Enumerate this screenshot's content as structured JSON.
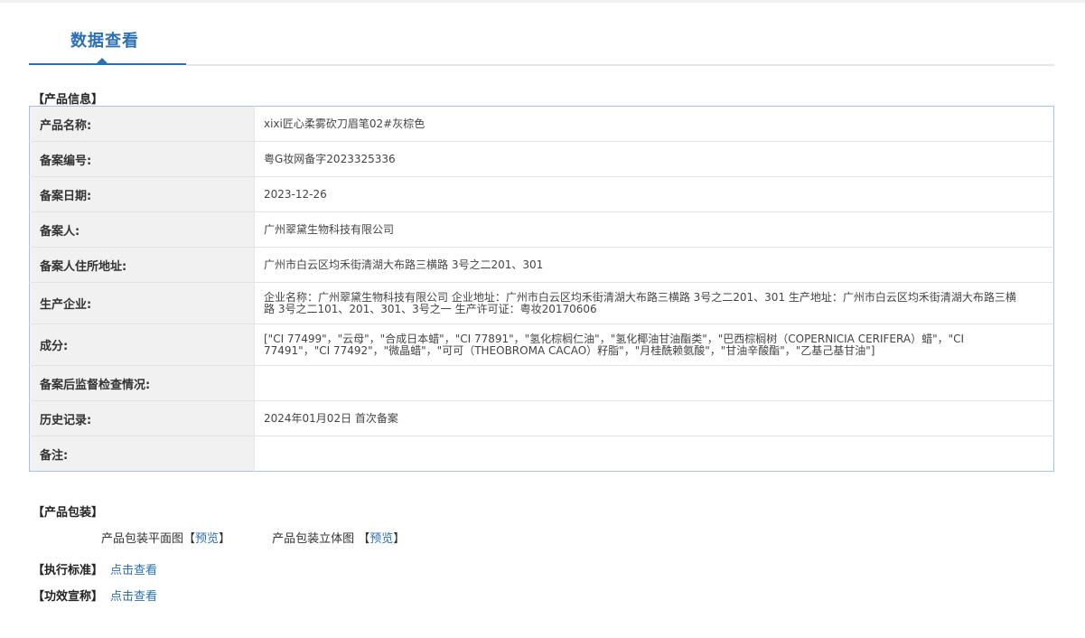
{
  "tab": {
    "title": "数据查看"
  },
  "sections": {
    "product_info": "【产品信息】",
    "packaging": "【产品包装】",
    "standard": "【执行标准】",
    "efficacy": "【功效宣称】"
  },
  "info_rows": [
    {
      "label": "产品名称:",
      "value": "xixi匠心柔雾砍刀眉笔02#灰棕色"
    },
    {
      "label": "备案编号:",
      "value": "粤G妆网备字2023325336"
    },
    {
      "label": "备案日期:",
      "value": "2023-12-26"
    },
    {
      "label": "备案人:",
      "value": "广州翠黛生物科技有限公司"
    },
    {
      "label": "备案人住所地址:",
      "value": "广州市白云区均禾街清湖大布路三横路 3号之二201、301"
    },
    {
      "label": "生产企业:",
      "value": "企业名称：广州翠黛生物科技有限公司 企业地址：广州市白云区均禾街清湖大布路三横路 3号之二201、301 生产地址：广州市白云区均禾街清湖大布路三横路 3号之二101、201、301、3号之一 生产许可证：粤妆20170606"
    },
    {
      "label": "成分:",
      "value": "[\"CI 77499\"，\"云母\"，\"合成日本蜡\"，\"CI 77891\"，\"氢化棕榈仁油\"，\"氢化椰油甘油酯类\"，\"巴西棕榈树（COPERNICIA CERIFERA）蜡\"，\"CI 77491\"，\"CI 77492\"，\"微晶蜡\"，\"可可（THEOBROMA CACAO）籽脂\"，\"月桂酰赖氨酸\"，\"甘油辛酸酯\"，\"乙基己基甘油\"]"
    },
    {
      "label": "备案后监督检查情况:",
      "value": ""
    },
    {
      "label": "历史记录:",
      "value": "2024年01月02日 首次备案"
    },
    {
      "label": "备注:",
      "value": ""
    }
  ],
  "packaging": {
    "flat_label": "产品包装平面图",
    "flat_link": "预览",
    "solid_label": "产品包装立体图",
    "solid_link": "预览",
    "bracket_open": "【",
    "bracket_close": "】"
  },
  "links": {
    "view_label": "点击查看"
  },
  "colors": {
    "accent": "#2b6fb5",
    "table_border": "#a8c3de",
    "label_bg": "#f1f1f1"
  }
}
